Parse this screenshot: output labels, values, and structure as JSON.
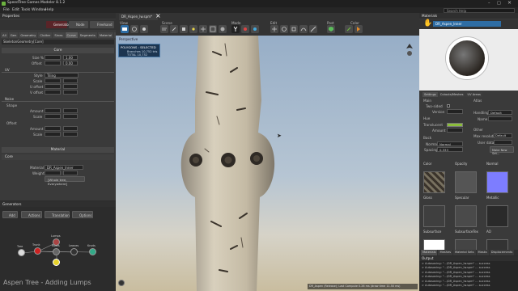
{
  "window": {
    "title": "SpeedTree Games Modeler 8.1.2",
    "search_placeholder": "Search Help"
  },
  "menu": {
    "items": [
      "File",
      "Edit",
      "Tools",
      "Window",
      "Help"
    ]
  },
  "toolbar": {
    "generator_label": "Generator",
    "node_label": "Node",
    "freehand_label": "Freehand",
    "view_label": "View",
    "scene_label": "Scene",
    "mode_label": "Mode",
    "edit_label": "Edit",
    "post_label": "Post",
    "color_label": "Color",
    "document_tab": "DR_Aspen_lw.spm*"
  },
  "properties": {
    "title": "Properties",
    "tabs": [
      "All",
      "Gen",
      "Geometry",
      "Clutter",
      "Sines",
      "Curve",
      "Segments",
      "Material",
      "LOD"
    ],
    "object_name": "SkeletonGeometry[Core]",
    "core_header": "Core",
    "size_label": "Size %",
    "size_value": "1.00",
    "offset_label": "Offset",
    "offset_value": "0.00",
    "uv_header": "UV",
    "style_label": "Style",
    "style_value": "Tiling",
    "scale_label": "Scale",
    "uoffset_label": "U offset",
    "voffset_label": "V offset",
    "noise_header": "Noise",
    "shape_label": "Shape",
    "amount_label": "Amount",
    "offset_section": "Offset",
    "material_header": "Material",
    "material_label": "Material",
    "material_value": "DR_Aspen_Inner",
    "weight_label": "Weight",
    "assign_button": "[Whole tree, Everywhere]",
    "core2_header": "Core"
  },
  "generators": {
    "title": "Generators",
    "buttons": [
      "Add",
      "Actions",
      "Translation",
      "Options"
    ],
    "caption": "Aspen Tree - Adding Lumps",
    "nodes": [
      "Tree",
      "Trunk",
      "Lumps",
      "Roots",
      "Leaves",
      "Knots"
    ]
  },
  "viewport": {
    "label": "Perspective",
    "selection_title": "POLYGONS : SELECTED",
    "stat_names": [
      "Branches",
      "TOTAL"
    ],
    "stat_values": [
      "10,752 tris",
      "10,752"
    ],
    "status": "DR_Aspen (Release); Last Compute 0.26 ms (draw time 11.50 ms)"
  },
  "materials": {
    "title": "Materials",
    "selected": "DR_Aspen_Inner",
    "tabs": [
      "Settings",
      "Cutouts/Meshes",
      "UV Areas"
    ],
    "main_section": "Main",
    "twosided_label": "Two-sided",
    "version_label": "Version",
    "hue_section": "Hue",
    "transluent_label": "Translucent",
    "amount_label": "Amount",
    "back_section": "Back",
    "normal_label": "Normal",
    "normal_value": "Normal",
    "spacing_label": "Spacing",
    "spacing_value": "0.333",
    "atlas_section": "Atlas",
    "handling_label": "Handling",
    "handling_value": "Default",
    "name_label": "Name",
    "other_section": "Other",
    "maxres_label": "Max resolution",
    "maxres_value": "Default",
    "userdata_label": "User data",
    "make_new_button": "Make New Set...",
    "maps": [
      "Color",
      "Opacity",
      "Normal",
      "Gloss",
      "Specular",
      "Metallic",
      "Subsurface",
      "SubsurfaceTex",
      "AO"
    ],
    "bottom_tabs": [
      "Materials",
      "Meshes",
      "Material Sets",
      "Masks",
      "Displacements"
    ]
  },
  "output": {
    "title": "Output",
    "lines": [
      "> Autosaving: \"...\\DR_Aspen_lw.spm\" ... success",
      "> Autosaving: \"...\\DR_Aspen_lw.spm\" ... success",
      "> Autosaving: \"...\\DR_Aspen_lw.spm\" ... success",
      "> Autosaving: \"...\\DR_Aspen_lw.spm\" ... success",
      "> Autosaving: \"...\\DR_Aspen_lw.spm\" ... success",
      "> Autosaving: \"...\\DR_Aspen_lw.spm\" ... success"
    ]
  },
  "colors": {
    "accent": "#2e6da4",
    "bark_light": "#cfc6b3",
    "bark_dark": "#3a332b",
    "sky_top": "#9fb6cf",
    "ground": "#cdbf9f",
    "translucent": "#8bbd3b",
    "normal_map": "#7d7dff"
  }
}
